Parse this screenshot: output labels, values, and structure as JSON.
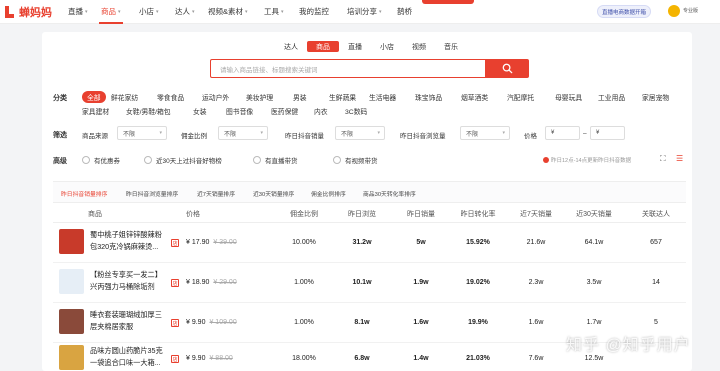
{
  "brand": {
    "name": "蝉妈妈",
    "color": "#e8402f"
  },
  "nav": [
    {
      "label": "直播",
      "caret": true
    },
    {
      "label": "商品",
      "caret": true,
      "active": true
    },
    {
      "label": "小店",
      "caret": true
    },
    {
      "label": "达人",
      "caret": true
    },
    {
      "label": "视频&素材",
      "caret": true
    },
    {
      "label": "工具",
      "caret": true
    },
    {
      "label": "我的监控",
      "caret": false
    },
    {
      "label": "培训分享",
      "caret": true
    },
    {
      "label": "鹊桥",
      "caret": false
    }
  ],
  "header": {
    "sync_label": "直播电商数据开箱",
    "pro_label": "专业版"
  },
  "category_tabs": [
    "达人",
    "商品",
    "直播",
    "小店",
    "视频",
    "音乐"
  ],
  "search": {
    "placeholder": "请输入商品链接、标题搜索关键词"
  },
  "category_row": {
    "label": "分类",
    "items": [
      "全部",
      "鲜花家纺",
      "零食食品",
      "运动户外",
      "美妆护理",
      "男装",
      "生鲜蔬果",
      "生活电器",
      "珠宝饰品",
      "烟草酒类",
      "汽配摩托",
      "母婴玩具",
      "工业用品",
      "家居宠物",
      "家具建材",
      "女鞋/男鞋/箱包",
      "女装",
      "图书音像",
      "医药保健",
      "内衣",
      "3C数码"
    ]
  },
  "filter_row": {
    "label": "筛选",
    "items": [
      {
        "label": "商品来源",
        "value": "不限"
      },
      {
        "label": "佣金比例",
        "value": "不限"
      },
      {
        "label": "昨日抖音销量",
        "value": "不限"
      },
      {
        "label": "昨日抖音浏览量",
        "value": "不限"
      },
      {
        "label": "价格",
        "value": "¥"
      }
    ],
    "price_to": "¥"
  },
  "advanced_row": {
    "label": "高级",
    "checks": [
      "有优惠券",
      "近30天上过抖音好物榜",
      "有直播带货",
      "有视频带货"
    ],
    "hint": "昨日12点-14点更新昨日抖音数据"
  },
  "sort_tabs": [
    "昨日抖音销量排序",
    "昨日抖音浏览量排序",
    "近7天销量排序",
    "近30天销量排序",
    "佣金比例排序",
    "商品30天转化率排序"
  ],
  "columns": [
    "商品",
    "价格",
    "佣金比例",
    "昨日浏览",
    "昨日销量",
    "昨日转化率",
    "近7天销量",
    "近30天销量",
    "关联达人"
  ],
  "products": [
    {
      "name": "蜀中桃子姐锌锌酸辣粉包320克冷锅麻辣烫...",
      "price": "¥ 17.90",
      "orig": "¥ 39.00",
      "commission": "10.00%",
      "views": "31.2w",
      "sales": "5w",
      "conversion": "15.92%",
      "sales7": "21.6w",
      "sales30": "64.1w",
      "kols": "657",
      "thumb_color": "#c83a2a"
    },
    {
      "name": "【粉丝专享买一发二】兴丙强力马桶除垢剂",
      "price": "¥ 18.90",
      "orig": "¥ 29.00",
      "commission": "1.00%",
      "views": "10.1w",
      "sales": "1.9w",
      "conversion": "19.02%",
      "sales7": "2.3w",
      "sales30": "3.5w",
      "kols": "14",
      "thumb_color": "#e6eef6"
    },
    {
      "name": "睡衣套装珊瑚绒加厚三层夹棉居家服",
      "price": "¥ 9.90",
      "orig": "¥ 109.00",
      "commission": "1.00%",
      "views": "8.1w",
      "sales": "1.6w",
      "conversion": "19.9%",
      "sales7": "1.6w",
      "sales30": "1.7w",
      "kols": "5",
      "thumb_color": "#8a4a3a"
    },
    {
      "name": "品味方圆山药脆片35克一袋追合口味一大箱...",
      "price": "¥ 9.90",
      "orig": "¥ 88.00",
      "commission": "18.00%",
      "views": "6.8w",
      "sales": "1.4w",
      "conversion": "21.03%",
      "sales7": "7.6w",
      "sales30": "12.5w",
      "kols": "",
      "thumb_color": "#d9a441"
    }
  ],
  "watermark": "知乎 @知乎用户"
}
